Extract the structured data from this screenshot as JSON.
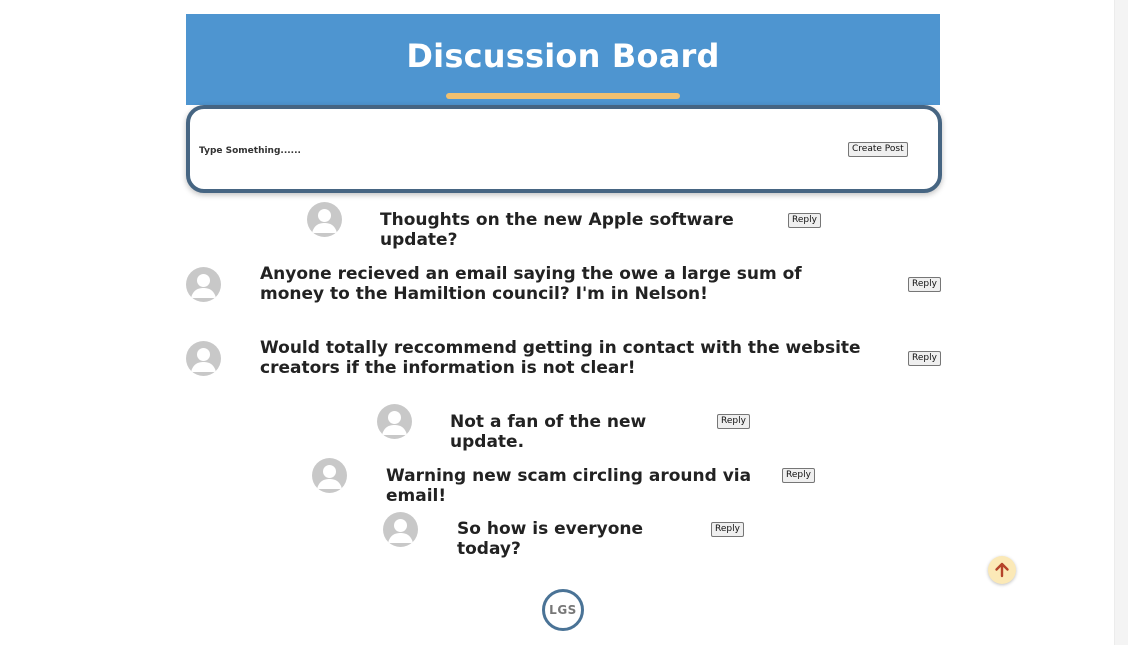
{
  "header": {
    "title": "Discussion Board"
  },
  "composer": {
    "placeholder": "Type Something......",
    "value": "",
    "create_label": "Create Post"
  },
  "posts": [
    {
      "text": "Thoughts on the new Apple software update?",
      "reply_label": "Reply"
    },
    {
      "text": "Anyone recieved an email saying the owe a large sum of money to the Hamiltion council? I'm in Nelson!",
      "reply_label": "Reply"
    },
    {
      "text": "Would totally reccommend getting in contact with the website creators if the information is not clear!",
      "reply_label": "Reply"
    },
    {
      "text": "Not a fan of the new update.",
      "reply_label": "Reply"
    },
    {
      "text": "Warning new scam circling around via email!",
      "reply_label": "Reply"
    },
    {
      "text": "So how is everyone today?",
      "reply_label": "Reply"
    }
  ],
  "footer": {
    "logo_text": "LGS"
  },
  "icons": {
    "avatar": "user-avatar-icon",
    "back_to_top": "arrow-up-icon"
  },
  "colors": {
    "header_bg": "#4e95d0",
    "header_underline": "#f0c070",
    "composer_border": "#466582",
    "avatar": "#c8c8c8",
    "back_to_top_bg": "#fbe9b7",
    "back_to_top_arrow": "#b5442a",
    "logo_ring": "#4a7396"
  }
}
